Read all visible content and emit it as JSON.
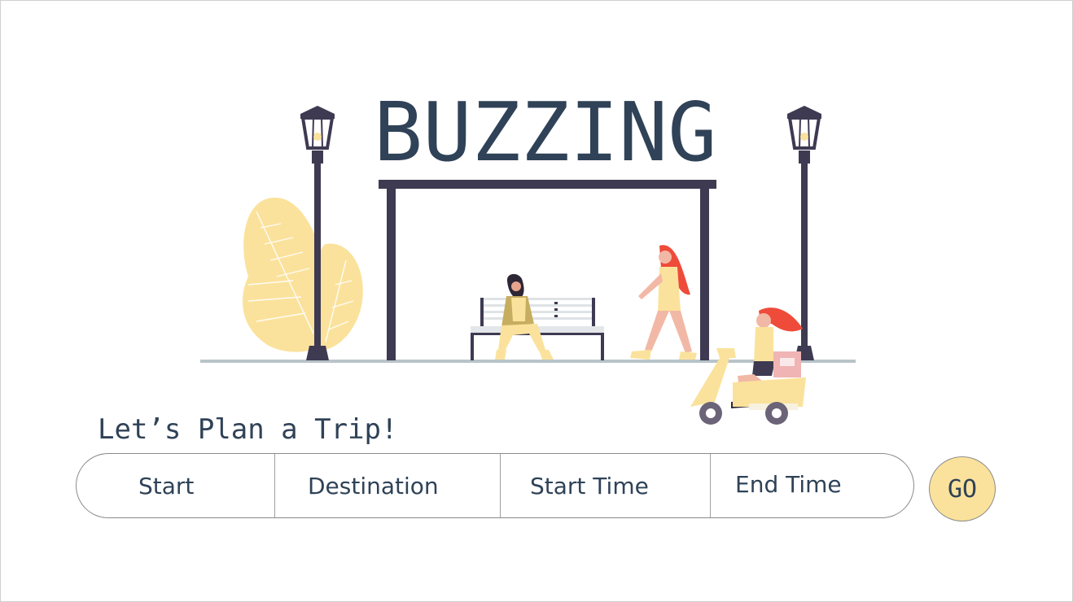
{
  "brand": {
    "title": "BUZZING"
  },
  "planner": {
    "heading": "Let’s Plan a Trip!",
    "fields": {
      "start": "Start",
      "destination": "Destination",
      "start_time": "Start Time",
      "end_time": "End Time"
    },
    "go_label": "GO"
  },
  "illustration": {
    "description_icons": [
      "street-lamp-icon",
      "bus-shelter-icon",
      "bench-icon",
      "plant-icon",
      "scooter-icon"
    ]
  },
  "colors": {
    "text": "#2f4257",
    "structure": "#3e3a52",
    "accent_yellow": "#fbe29c",
    "ground": "#b8c4c8",
    "hair_red": "#ef4b3a"
  }
}
